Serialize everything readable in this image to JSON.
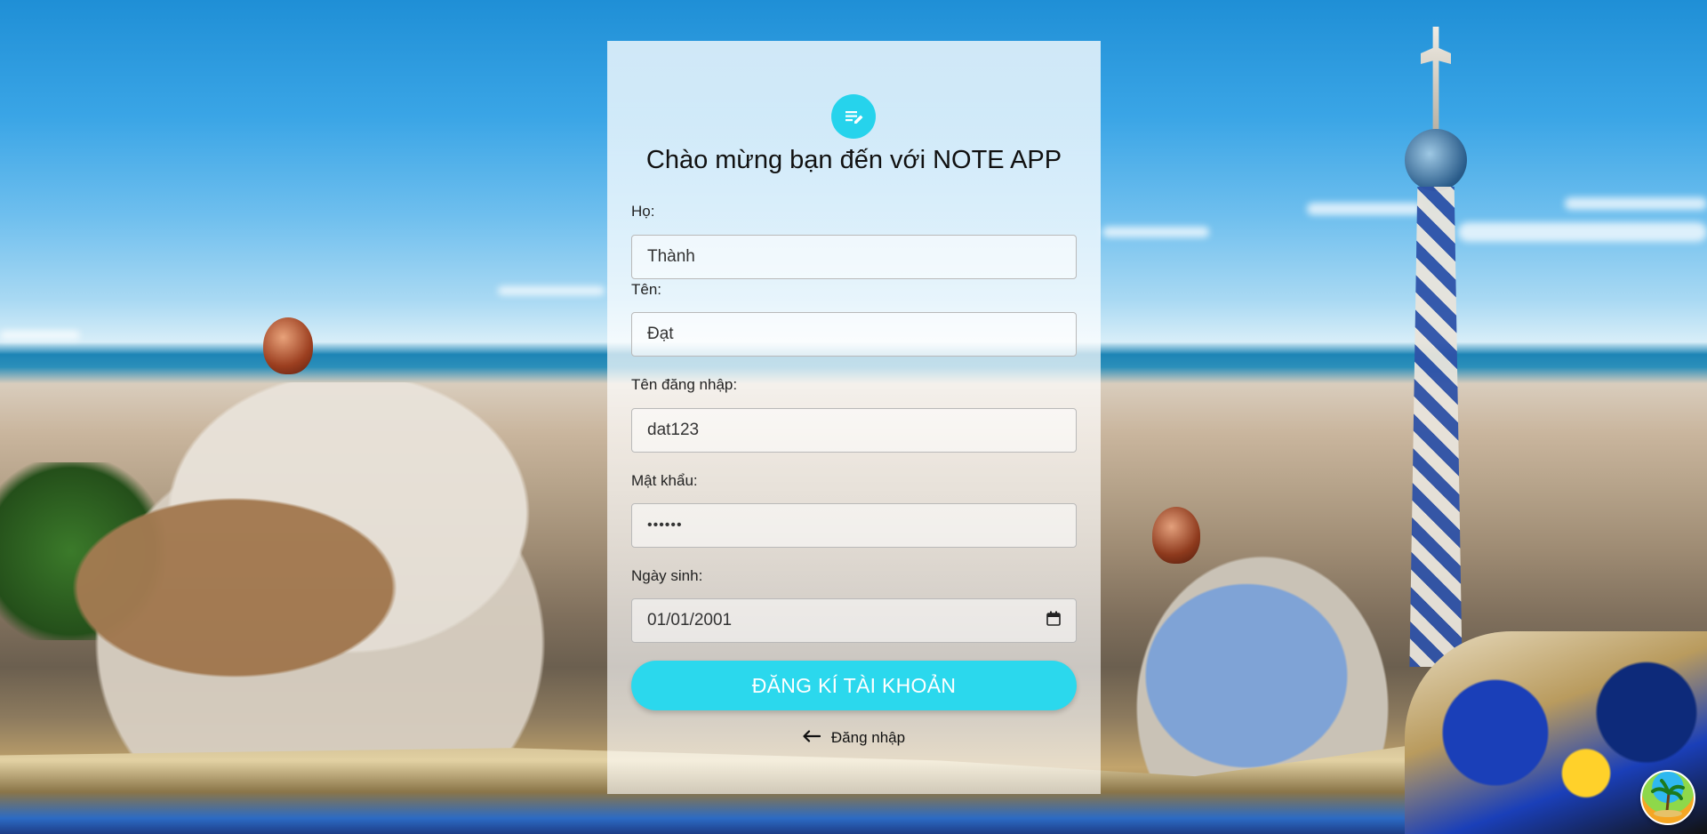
{
  "app": {
    "title": "Chào mừng bạn đến với NOTE APP",
    "logo_icon": "note-edit-icon",
    "accent_color": "#2bd8ed"
  },
  "form": {
    "last_name": {
      "label": "Họ:",
      "value": "Thành"
    },
    "first_name": {
      "label": "Tên:",
      "value": "Đạt"
    },
    "username": {
      "label": "Tên đăng nhập:",
      "value": "dat123"
    },
    "password": {
      "label": "Mật khẩu:",
      "value": "••••••"
    },
    "birthday": {
      "label": "Ngày sinh:",
      "value": "01/01/2001",
      "icon": "calendar-icon"
    },
    "submit_label": "ĐĂNG KÍ TÀI KHOẢN",
    "login_link": {
      "label": "Đăng nhập",
      "icon": "arrow-left-icon"
    }
  },
  "corner_badge": {
    "icon": "palm-tree-icon"
  }
}
